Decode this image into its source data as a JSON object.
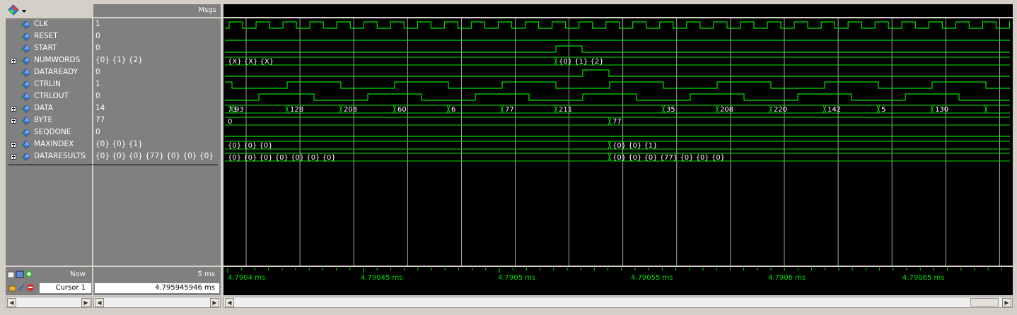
{
  "header": {
    "msgs_label": "Msgs"
  },
  "signals": [
    {
      "name": "CLK",
      "value": "1",
      "expandable": false
    },
    {
      "name": "RESET",
      "value": "0",
      "expandable": false
    },
    {
      "name": "START",
      "value": "0",
      "expandable": false
    },
    {
      "name": "NUMWORDS",
      "value": "{0} {1} {2}",
      "expandable": true
    },
    {
      "name": "DATAREADY",
      "value": "0",
      "expandable": false
    },
    {
      "name": "CTRLIN",
      "value": "1",
      "expandable": false
    },
    {
      "name": "CTRLOUT",
      "value": "0",
      "expandable": false
    },
    {
      "name": "DATA",
      "value": "14",
      "expandable": true
    },
    {
      "name": "BYTE",
      "value": "77",
      "expandable": true
    },
    {
      "name": "SEQDONE",
      "value": "0",
      "expandable": false
    },
    {
      "name": "MAXINDEX",
      "value": "{0} {0} {1}",
      "expandable": true
    },
    {
      "name": "DATARESULTS",
      "value": "{0} {0} {0} {77} {0} {0} {0}",
      "expandable": true
    }
  ],
  "bus_labels": {
    "numwords": [
      "{X} {X} {X}",
      "{0} {1} {2}"
    ],
    "data": [
      "73",
      "93",
      "128",
      "208",
      "60",
      "6",
      "77",
      "211",
      "35",
      "208",
      "220",
      "142",
      "5",
      "130"
    ],
    "byte": [
      "0",
      "77"
    ],
    "maxindex": [
      "{0} {0} {0}",
      "{0} {0} {1}"
    ],
    "dataresults": [
      "{0} {0} {0} {0} {0} {0} {0}",
      "{0} {0} {0} {77} {0} {0} {0}"
    ]
  },
  "footer": {
    "now_label": "Now",
    "now_value": "5 ms",
    "cursor_label": "Cursor 1",
    "cursor_value": "4.795945946 ms"
  },
  "timeline": [
    "4.7904 ms",
    "4.79045 ms",
    "4.7905 ms",
    "4.79055 ms",
    "4.7906 ms",
    "4.79065 ms"
  ],
  "colors": {
    "wave": "#00e000",
    "gridline": "#c0c0c0",
    "background": "#000000",
    "panel": "#808080"
  }
}
